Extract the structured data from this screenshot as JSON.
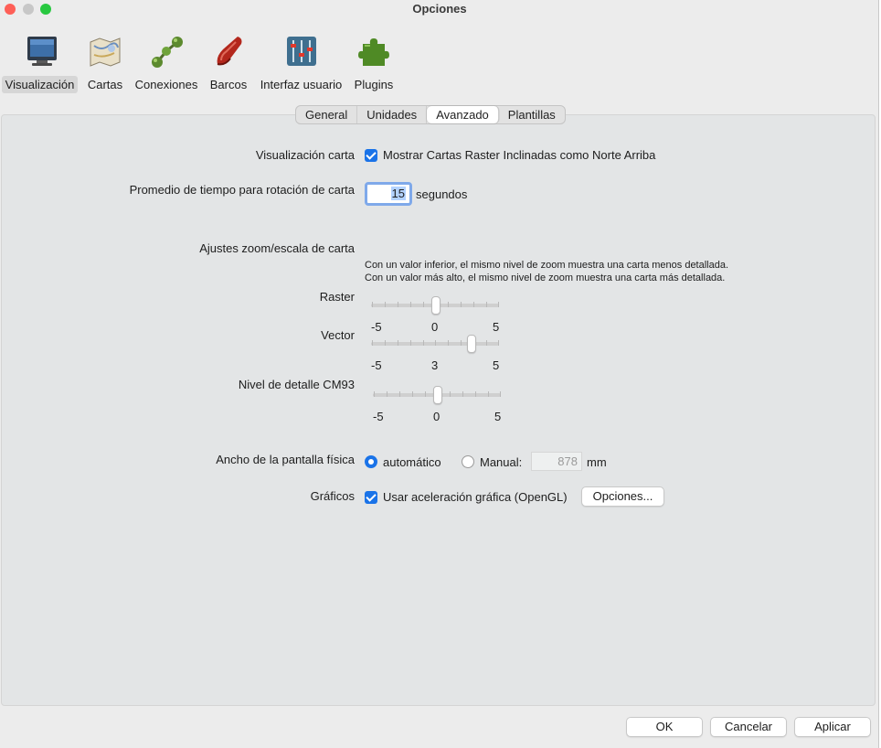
{
  "window": {
    "title": "Opciones"
  },
  "toolbar": {
    "items": [
      {
        "label": "Visualización",
        "icon": "monitor-icon"
      },
      {
        "label": "Cartas",
        "icon": "charts-icon"
      },
      {
        "label": "Conexiones",
        "icon": "connections-icon"
      },
      {
        "label": "Barcos",
        "icon": "boat-icon"
      },
      {
        "label": "Interfaz usuario",
        "icon": "sliders-icon"
      },
      {
        "label": "Plugins",
        "icon": "puzzle-icon"
      }
    ],
    "selected": "Visualización"
  },
  "tabs": [
    {
      "label": "General"
    },
    {
      "label": "Unidades"
    },
    {
      "label": "Avanzado",
      "active": true
    },
    {
      "label": "Plantillas"
    }
  ],
  "advanced": {
    "chart_display": {
      "label": "Visualización carta",
      "checkbox_label": "Mostrar Cartas Raster Inclinadas como Norte Arriba",
      "checked": true
    },
    "rotation_avg": {
      "label": "Promedio de tiempo para rotación de carta",
      "value": "15",
      "unit": "segundos"
    },
    "zoom": {
      "label": "Ajustes zoom/escala de carta",
      "help_line1": "Con un valor inferior, el mismo nivel de zoom muestra una carta menos detallada.",
      "help_line2": "Con un valor más alto, el mismo nivel de zoom muestra una carta más detallada.",
      "raster": {
        "label": "Raster",
        "min": "-5",
        "value": "0",
        "max": "5"
      },
      "vector": {
        "label": "Vector",
        "min": "-5",
        "value": "3",
        "max": "5"
      },
      "cm93": {
        "label": "Nivel de detalle CM93",
        "min": "-5",
        "value": "0",
        "max": "5"
      }
    },
    "screen_width": {
      "label": "Ancho de la pantalla física",
      "auto_label": "automático",
      "manual_label": "Manual:",
      "value": "878",
      "unit": "mm",
      "selected": "automático"
    },
    "graphics": {
      "label": "Gráficos",
      "checkbox_label": "Usar aceleración gráfica (OpenGL)",
      "checked": true,
      "options_button": "Opciones..."
    }
  },
  "footer": {
    "ok": "OK",
    "cancel": "Cancelar",
    "apply": "Aplicar"
  },
  "colors": {
    "accent": "#1a73e8",
    "close": "#fe5f57",
    "minimize": "#febc2e",
    "zoom": "#28c840"
  }
}
